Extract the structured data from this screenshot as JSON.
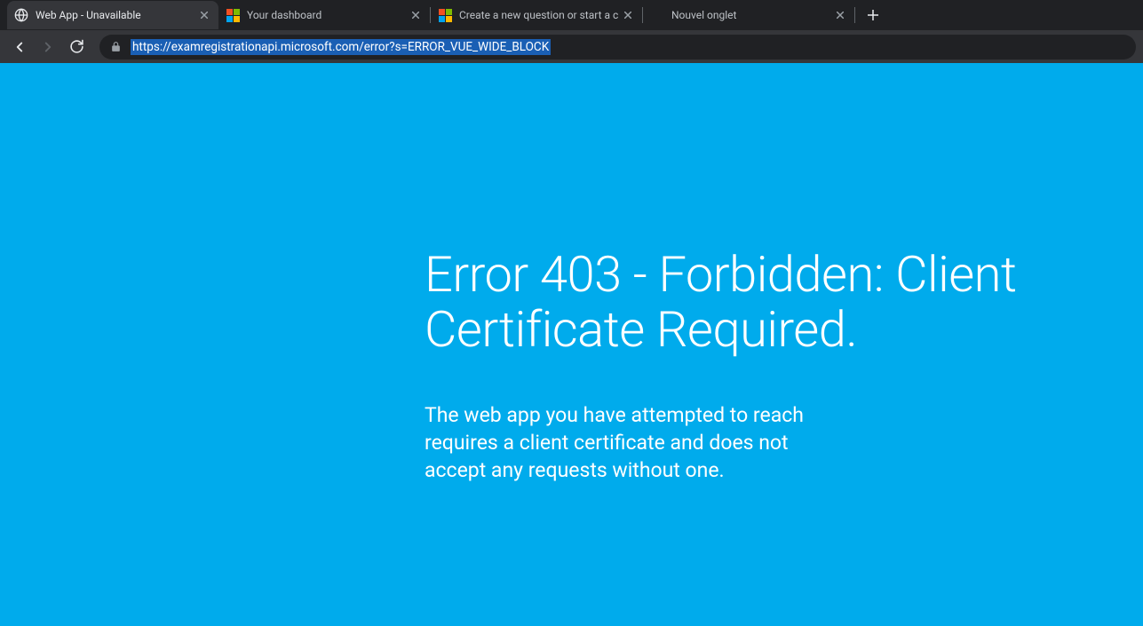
{
  "tabs": [
    {
      "title": "Web App - Unavailable",
      "icon": "globe",
      "active": true
    },
    {
      "title": "Your dashboard",
      "icon": "ms",
      "active": false
    },
    {
      "title": "Create a new question or start a c",
      "icon": "ms",
      "active": false
    },
    {
      "title": "Nouvel onglet",
      "icon": "none",
      "active": false
    }
  ],
  "addressBar": {
    "url": "https://examregistrationapi.microsoft.com/error?s=ERROR_VUE_WIDE_BLOCK"
  },
  "page": {
    "heading": "Error 403 - Forbidden: Client Certificate Required.",
    "message": "The web app you have attempted to reach requires a client certificate and does not accept any requests without one."
  }
}
